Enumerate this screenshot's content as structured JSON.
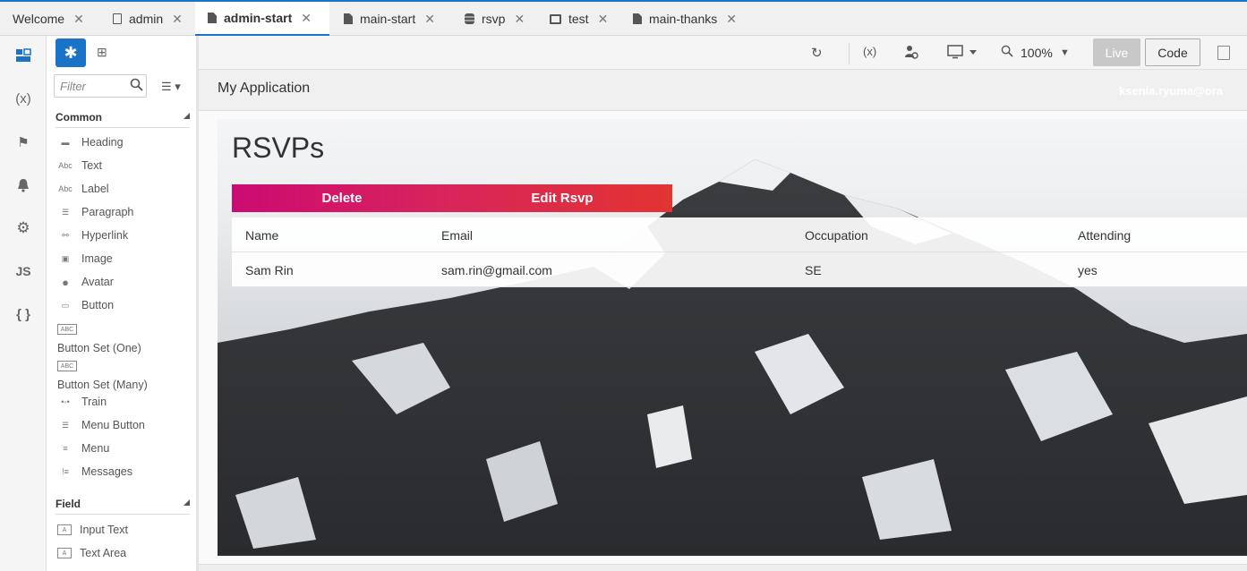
{
  "tabs": [
    {
      "label": "Welcome",
      "icon": "",
      "active": false
    },
    {
      "label": "admin",
      "icon": "copy-icon",
      "active": false
    },
    {
      "label": "admin-start",
      "icon": "page-icon",
      "active": true
    },
    {
      "label": "main-start",
      "icon": "page-icon",
      "active": false
    },
    {
      "label": "rsvp",
      "icon": "database-icon",
      "active": false
    },
    {
      "label": "test",
      "icon": "monitor-icon",
      "active": false
    },
    {
      "label": "main-thanks",
      "icon": "page-icon",
      "active": false
    }
  ],
  "rail": {
    "variables": "(x)",
    "js": "JS",
    "json": "{ }"
  },
  "palette": {
    "filter_placeholder": "Filter",
    "sections": {
      "common": "Common",
      "field": "Field"
    },
    "common_items": [
      "Heading",
      "Text",
      "Label",
      "Paragraph",
      "Hyperlink",
      "Image",
      "Avatar",
      "Button",
      "Button Set (One)",
      "Button Set (Many)",
      "Train",
      "Menu Button",
      "Menu",
      "Messages"
    ],
    "field_items": [
      "Input Text",
      "Text Area"
    ]
  },
  "toolbar": {
    "zoom": "100%",
    "live": "Live",
    "code": "Code"
  },
  "app": {
    "title": "My Application",
    "user": "ksenia.ryuma@ora"
  },
  "page": {
    "heading": "RSVPs",
    "buttons": {
      "delete": "Delete",
      "edit": "Edit Rsvp"
    },
    "table": {
      "columns": [
        "Name",
        "Email",
        "Occupation",
        "Attending"
      ],
      "rows": [
        [
          "Sam Rin",
          "sam.rin@gmail.com",
          "SE",
          "yes"
        ]
      ]
    }
  }
}
